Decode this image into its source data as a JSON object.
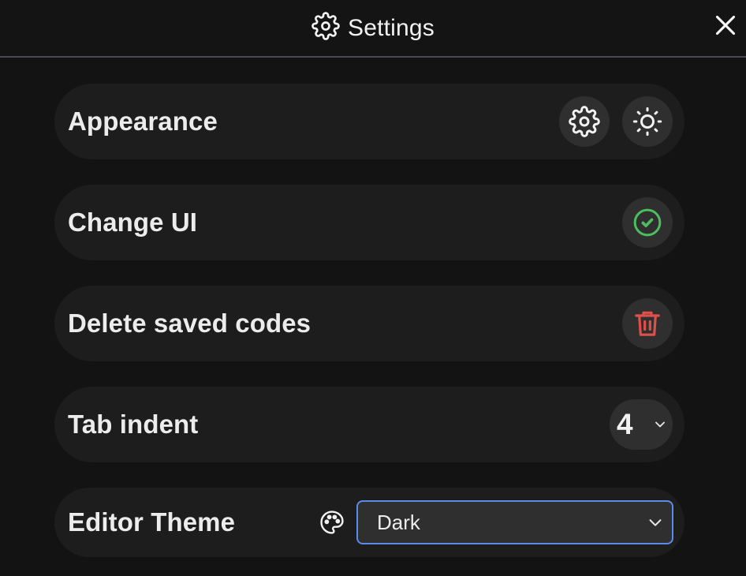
{
  "header": {
    "title": "Settings",
    "icon": "gear-icon",
    "close_icon": "close-icon"
  },
  "rows": {
    "appearance": {
      "label": "Appearance",
      "buttons": [
        "gear-icon",
        "sun-icon"
      ]
    },
    "change_ui": {
      "label": "Change UI",
      "icon": "check-circle-icon",
      "icon_color": "#4dbd5f"
    },
    "delete_codes": {
      "label": "Delete saved codes",
      "icon": "trash-icon",
      "icon_color": "#e0504a"
    },
    "tab_indent": {
      "label": "Tab indent",
      "value": "4"
    },
    "editor_theme": {
      "label": "Editor Theme",
      "icon": "palette-icon",
      "value": "Dark",
      "focus_color": "#5b8bea"
    }
  },
  "colors": {
    "background": "#131313",
    "row": "#1d1d1d",
    "button": "#2f2f2f"
  }
}
